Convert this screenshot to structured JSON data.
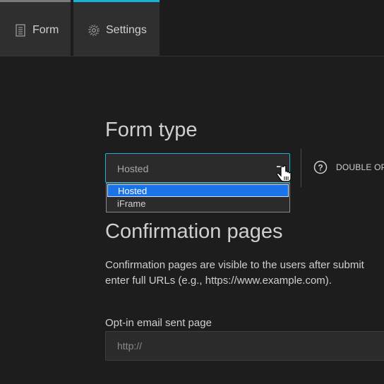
{
  "tabs": [
    {
      "label": "Form",
      "icon": "document-icon",
      "accent": "#7a7a7a"
    },
    {
      "label": "Settings",
      "icon": "gear-icon",
      "accent": "#17b3d6"
    }
  ],
  "form_type": {
    "heading": "Form type",
    "select": {
      "value": "Hosted",
      "options": [
        "Hosted",
        "iFrame"
      ],
      "highlighted": "Hosted"
    },
    "double_opt_label": "DOUBLE OP"
  },
  "confirmation": {
    "heading": "Confirmation pages",
    "description_line1": "Confirmation pages are visible to the users after submit",
    "description_line2": "enter full URLs (e.g., https://www.example.com).",
    "optin": {
      "label": "Opt-in email sent page",
      "placeholder": "http://"
    }
  },
  "colors": {
    "accent": "#17b3d6",
    "background": "#1d1d1d",
    "selection": "#1a73e8"
  }
}
